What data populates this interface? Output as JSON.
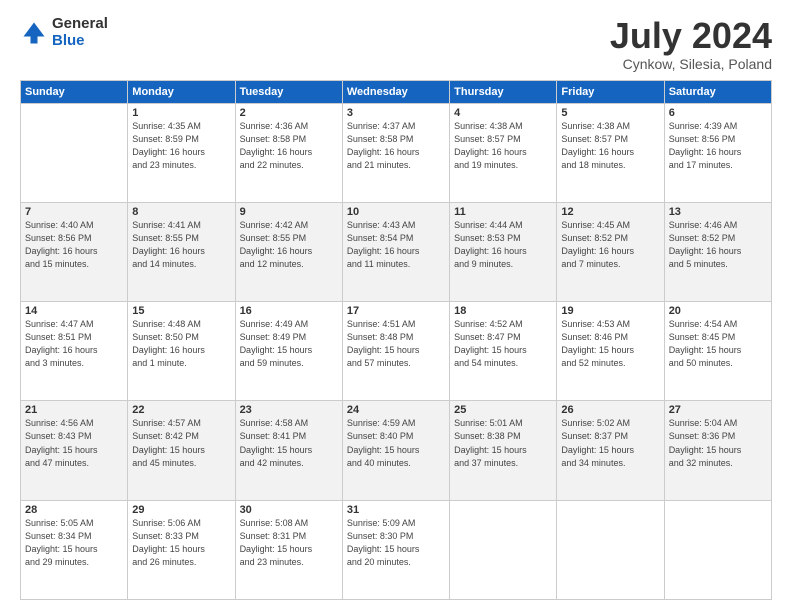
{
  "logo": {
    "general": "General",
    "blue": "Blue"
  },
  "title": "July 2024",
  "subtitle": "Cynkow, Silesia, Poland",
  "days_of_week": [
    "Sunday",
    "Monday",
    "Tuesday",
    "Wednesday",
    "Thursday",
    "Friday",
    "Saturday"
  ],
  "weeks": [
    [
      {
        "day": "",
        "info": ""
      },
      {
        "day": "1",
        "info": "Sunrise: 4:35 AM\nSunset: 8:59 PM\nDaylight: 16 hours\nand 23 minutes."
      },
      {
        "day": "2",
        "info": "Sunrise: 4:36 AM\nSunset: 8:58 PM\nDaylight: 16 hours\nand 22 minutes."
      },
      {
        "day": "3",
        "info": "Sunrise: 4:37 AM\nSunset: 8:58 PM\nDaylight: 16 hours\nand 21 minutes."
      },
      {
        "day": "4",
        "info": "Sunrise: 4:38 AM\nSunset: 8:57 PM\nDaylight: 16 hours\nand 19 minutes."
      },
      {
        "day": "5",
        "info": "Sunrise: 4:38 AM\nSunset: 8:57 PM\nDaylight: 16 hours\nand 18 minutes."
      },
      {
        "day": "6",
        "info": "Sunrise: 4:39 AM\nSunset: 8:56 PM\nDaylight: 16 hours\nand 17 minutes."
      }
    ],
    [
      {
        "day": "7",
        "info": "Sunrise: 4:40 AM\nSunset: 8:56 PM\nDaylight: 16 hours\nand 15 minutes."
      },
      {
        "day": "8",
        "info": "Sunrise: 4:41 AM\nSunset: 8:55 PM\nDaylight: 16 hours\nand 14 minutes."
      },
      {
        "day": "9",
        "info": "Sunrise: 4:42 AM\nSunset: 8:55 PM\nDaylight: 16 hours\nand 12 minutes."
      },
      {
        "day": "10",
        "info": "Sunrise: 4:43 AM\nSunset: 8:54 PM\nDaylight: 16 hours\nand 11 minutes."
      },
      {
        "day": "11",
        "info": "Sunrise: 4:44 AM\nSunset: 8:53 PM\nDaylight: 16 hours\nand 9 minutes."
      },
      {
        "day": "12",
        "info": "Sunrise: 4:45 AM\nSunset: 8:52 PM\nDaylight: 16 hours\nand 7 minutes."
      },
      {
        "day": "13",
        "info": "Sunrise: 4:46 AM\nSunset: 8:52 PM\nDaylight: 16 hours\nand 5 minutes."
      }
    ],
    [
      {
        "day": "14",
        "info": "Sunrise: 4:47 AM\nSunset: 8:51 PM\nDaylight: 16 hours\nand 3 minutes."
      },
      {
        "day": "15",
        "info": "Sunrise: 4:48 AM\nSunset: 8:50 PM\nDaylight: 16 hours\nand 1 minute."
      },
      {
        "day": "16",
        "info": "Sunrise: 4:49 AM\nSunset: 8:49 PM\nDaylight: 15 hours\nand 59 minutes."
      },
      {
        "day": "17",
        "info": "Sunrise: 4:51 AM\nSunset: 8:48 PM\nDaylight: 15 hours\nand 57 minutes."
      },
      {
        "day": "18",
        "info": "Sunrise: 4:52 AM\nSunset: 8:47 PM\nDaylight: 15 hours\nand 54 minutes."
      },
      {
        "day": "19",
        "info": "Sunrise: 4:53 AM\nSunset: 8:46 PM\nDaylight: 15 hours\nand 52 minutes."
      },
      {
        "day": "20",
        "info": "Sunrise: 4:54 AM\nSunset: 8:45 PM\nDaylight: 15 hours\nand 50 minutes."
      }
    ],
    [
      {
        "day": "21",
        "info": "Sunrise: 4:56 AM\nSunset: 8:43 PM\nDaylight: 15 hours\nand 47 minutes."
      },
      {
        "day": "22",
        "info": "Sunrise: 4:57 AM\nSunset: 8:42 PM\nDaylight: 15 hours\nand 45 minutes."
      },
      {
        "day": "23",
        "info": "Sunrise: 4:58 AM\nSunset: 8:41 PM\nDaylight: 15 hours\nand 42 minutes."
      },
      {
        "day": "24",
        "info": "Sunrise: 4:59 AM\nSunset: 8:40 PM\nDaylight: 15 hours\nand 40 minutes."
      },
      {
        "day": "25",
        "info": "Sunrise: 5:01 AM\nSunset: 8:38 PM\nDaylight: 15 hours\nand 37 minutes."
      },
      {
        "day": "26",
        "info": "Sunrise: 5:02 AM\nSunset: 8:37 PM\nDaylight: 15 hours\nand 34 minutes."
      },
      {
        "day": "27",
        "info": "Sunrise: 5:04 AM\nSunset: 8:36 PM\nDaylight: 15 hours\nand 32 minutes."
      }
    ],
    [
      {
        "day": "28",
        "info": "Sunrise: 5:05 AM\nSunset: 8:34 PM\nDaylight: 15 hours\nand 29 minutes."
      },
      {
        "day": "29",
        "info": "Sunrise: 5:06 AM\nSunset: 8:33 PM\nDaylight: 15 hours\nand 26 minutes."
      },
      {
        "day": "30",
        "info": "Sunrise: 5:08 AM\nSunset: 8:31 PM\nDaylight: 15 hours\nand 23 minutes."
      },
      {
        "day": "31",
        "info": "Sunrise: 5:09 AM\nSunset: 8:30 PM\nDaylight: 15 hours\nand 20 minutes."
      },
      {
        "day": "",
        "info": ""
      },
      {
        "day": "",
        "info": ""
      },
      {
        "day": "",
        "info": ""
      }
    ]
  ]
}
